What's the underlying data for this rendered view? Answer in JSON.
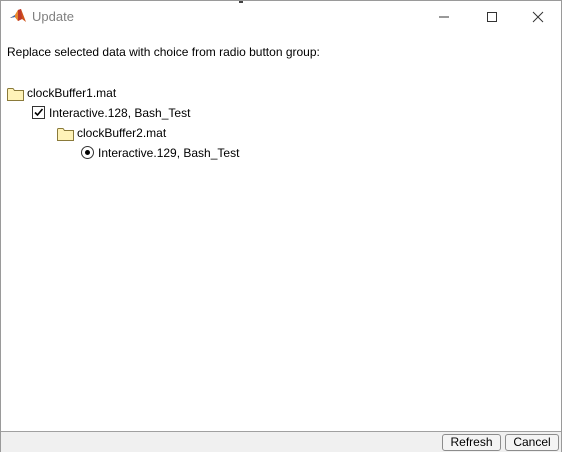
{
  "window": {
    "title": "Update"
  },
  "instruction": "Replace selected data with choice from radio button group:",
  "tree": {
    "file1": {
      "label": "clockBuffer1.mat",
      "icon": "folder-icon"
    },
    "item1": {
      "label": "Interactive.128, Bash_Test",
      "checked": true
    },
    "file2": {
      "label": "clockBuffer2.mat",
      "icon": "folder-icon"
    },
    "item2": {
      "label": "Interactive.129, Bash_Test",
      "selected": true
    }
  },
  "footer": {
    "refresh_label": "Refresh",
    "cancel_label": "Cancel"
  },
  "colors": {
    "folder_fill": "#fff3b8",
    "folder_stroke": "#8a7a3a",
    "footer_bg": "#f0f0f0",
    "title_text": "#808080"
  }
}
